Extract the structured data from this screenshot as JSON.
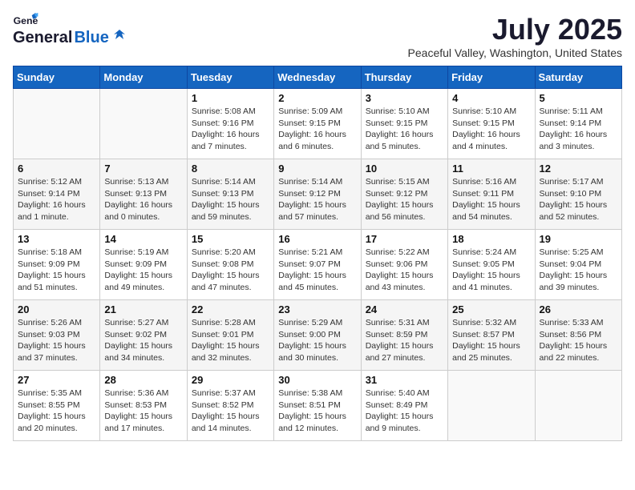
{
  "header": {
    "logo_general": "General",
    "logo_blue": "Blue",
    "month_title": "July 2025",
    "location": "Peaceful Valley, Washington, United States"
  },
  "days_of_week": [
    "Sunday",
    "Monday",
    "Tuesday",
    "Wednesday",
    "Thursday",
    "Friday",
    "Saturday"
  ],
  "weeks": [
    [
      {
        "day": "",
        "detail": ""
      },
      {
        "day": "",
        "detail": ""
      },
      {
        "day": "1",
        "detail": "Sunrise: 5:08 AM\nSunset: 9:16 PM\nDaylight: 16 hours\nand 7 minutes."
      },
      {
        "day": "2",
        "detail": "Sunrise: 5:09 AM\nSunset: 9:15 PM\nDaylight: 16 hours\nand 6 minutes."
      },
      {
        "day": "3",
        "detail": "Sunrise: 5:10 AM\nSunset: 9:15 PM\nDaylight: 16 hours\nand 5 minutes."
      },
      {
        "day": "4",
        "detail": "Sunrise: 5:10 AM\nSunset: 9:15 PM\nDaylight: 16 hours\nand 4 minutes."
      },
      {
        "day": "5",
        "detail": "Sunrise: 5:11 AM\nSunset: 9:14 PM\nDaylight: 16 hours\nand 3 minutes."
      }
    ],
    [
      {
        "day": "6",
        "detail": "Sunrise: 5:12 AM\nSunset: 9:14 PM\nDaylight: 16 hours\nand 1 minute."
      },
      {
        "day": "7",
        "detail": "Sunrise: 5:13 AM\nSunset: 9:13 PM\nDaylight: 16 hours\nand 0 minutes."
      },
      {
        "day": "8",
        "detail": "Sunrise: 5:14 AM\nSunset: 9:13 PM\nDaylight: 15 hours\nand 59 minutes."
      },
      {
        "day": "9",
        "detail": "Sunrise: 5:14 AM\nSunset: 9:12 PM\nDaylight: 15 hours\nand 57 minutes."
      },
      {
        "day": "10",
        "detail": "Sunrise: 5:15 AM\nSunset: 9:12 PM\nDaylight: 15 hours\nand 56 minutes."
      },
      {
        "day": "11",
        "detail": "Sunrise: 5:16 AM\nSunset: 9:11 PM\nDaylight: 15 hours\nand 54 minutes."
      },
      {
        "day": "12",
        "detail": "Sunrise: 5:17 AM\nSunset: 9:10 PM\nDaylight: 15 hours\nand 52 minutes."
      }
    ],
    [
      {
        "day": "13",
        "detail": "Sunrise: 5:18 AM\nSunset: 9:09 PM\nDaylight: 15 hours\nand 51 minutes."
      },
      {
        "day": "14",
        "detail": "Sunrise: 5:19 AM\nSunset: 9:09 PM\nDaylight: 15 hours\nand 49 minutes."
      },
      {
        "day": "15",
        "detail": "Sunrise: 5:20 AM\nSunset: 9:08 PM\nDaylight: 15 hours\nand 47 minutes."
      },
      {
        "day": "16",
        "detail": "Sunrise: 5:21 AM\nSunset: 9:07 PM\nDaylight: 15 hours\nand 45 minutes."
      },
      {
        "day": "17",
        "detail": "Sunrise: 5:22 AM\nSunset: 9:06 PM\nDaylight: 15 hours\nand 43 minutes."
      },
      {
        "day": "18",
        "detail": "Sunrise: 5:24 AM\nSunset: 9:05 PM\nDaylight: 15 hours\nand 41 minutes."
      },
      {
        "day": "19",
        "detail": "Sunrise: 5:25 AM\nSunset: 9:04 PM\nDaylight: 15 hours\nand 39 minutes."
      }
    ],
    [
      {
        "day": "20",
        "detail": "Sunrise: 5:26 AM\nSunset: 9:03 PM\nDaylight: 15 hours\nand 37 minutes."
      },
      {
        "day": "21",
        "detail": "Sunrise: 5:27 AM\nSunset: 9:02 PM\nDaylight: 15 hours\nand 34 minutes."
      },
      {
        "day": "22",
        "detail": "Sunrise: 5:28 AM\nSunset: 9:01 PM\nDaylight: 15 hours\nand 32 minutes."
      },
      {
        "day": "23",
        "detail": "Sunrise: 5:29 AM\nSunset: 9:00 PM\nDaylight: 15 hours\nand 30 minutes."
      },
      {
        "day": "24",
        "detail": "Sunrise: 5:31 AM\nSunset: 8:59 PM\nDaylight: 15 hours\nand 27 minutes."
      },
      {
        "day": "25",
        "detail": "Sunrise: 5:32 AM\nSunset: 8:57 PM\nDaylight: 15 hours\nand 25 minutes."
      },
      {
        "day": "26",
        "detail": "Sunrise: 5:33 AM\nSunset: 8:56 PM\nDaylight: 15 hours\nand 22 minutes."
      }
    ],
    [
      {
        "day": "27",
        "detail": "Sunrise: 5:35 AM\nSunset: 8:55 PM\nDaylight: 15 hours\nand 20 minutes."
      },
      {
        "day": "28",
        "detail": "Sunrise: 5:36 AM\nSunset: 8:53 PM\nDaylight: 15 hours\nand 17 minutes."
      },
      {
        "day": "29",
        "detail": "Sunrise: 5:37 AM\nSunset: 8:52 PM\nDaylight: 15 hours\nand 14 minutes."
      },
      {
        "day": "30",
        "detail": "Sunrise: 5:38 AM\nSunset: 8:51 PM\nDaylight: 15 hours\nand 12 minutes."
      },
      {
        "day": "31",
        "detail": "Sunrise: 5:40 AM\nSunset: 8:49 PM\nDaylight: 15 hours\nand 9 minutes."
      },
      {
        "day": "",
        "detail": ""
      },
      {
        "day": "",
        "detail": ""
      }
    ]
  ]
}
